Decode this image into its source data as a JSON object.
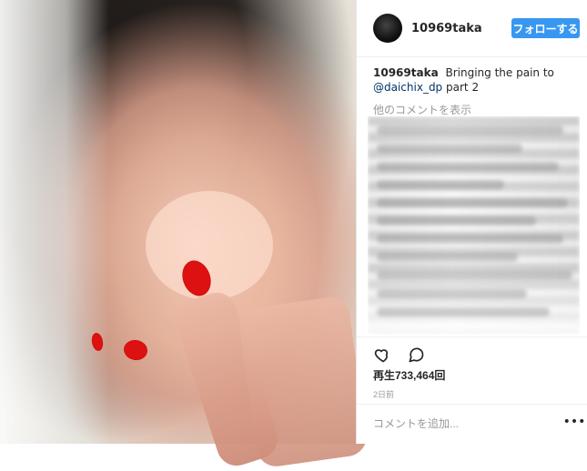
{
  "post": {
    "username": "10969taka",
    "follow_label": "フォローする",
    "caption_text": "Bringing the pain to",
    "caption_mention": "@daichix_dp",
    "caption_suffix": "part 2",
    "more_comments_label": "他のコメントを表示",
    "views_label": "再生733,464回",
    "time_ago": "2日前",
    "comment_placeholder": "コメントを追加...",
    "more_label": "•••"
  },
  "icons": {
    "like": "heart-outline",
    "comment": "speech-bubble-outline",
    "more": "ellipsis"
  },
  "colors": {
    "accent": "#3897f0",
    "text": "#262626",
    "muted": "#999999",
    "divider": "#efefef"
  }
}
